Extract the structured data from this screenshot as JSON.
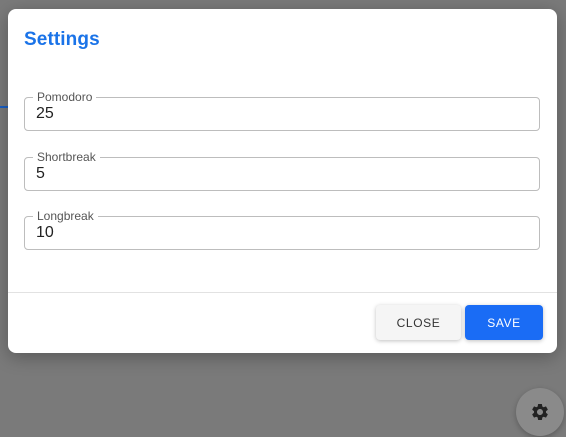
{
  "dialog": {
    "title": "Settings",
    "fields": [
      {
        "label": "Pomodoro",
        "value": "25"
      },
      {
        "label": "Shortbreak",
        "value": "5"
      },
      {
        "label": "Longbreak",
        "value": "10"
      }
    ],
    "buttons": {
      "close_label": "CLOSE",
      "save_label": "SAVE"
    }
  },
  "fab": {
    "icon": "gear-icon"
  },
  "colors": {
    "accent": "#1a73e8",
    "primary_button": "#1a6cf5",
    "backdrop": "#7a7a7a"
  }
}
